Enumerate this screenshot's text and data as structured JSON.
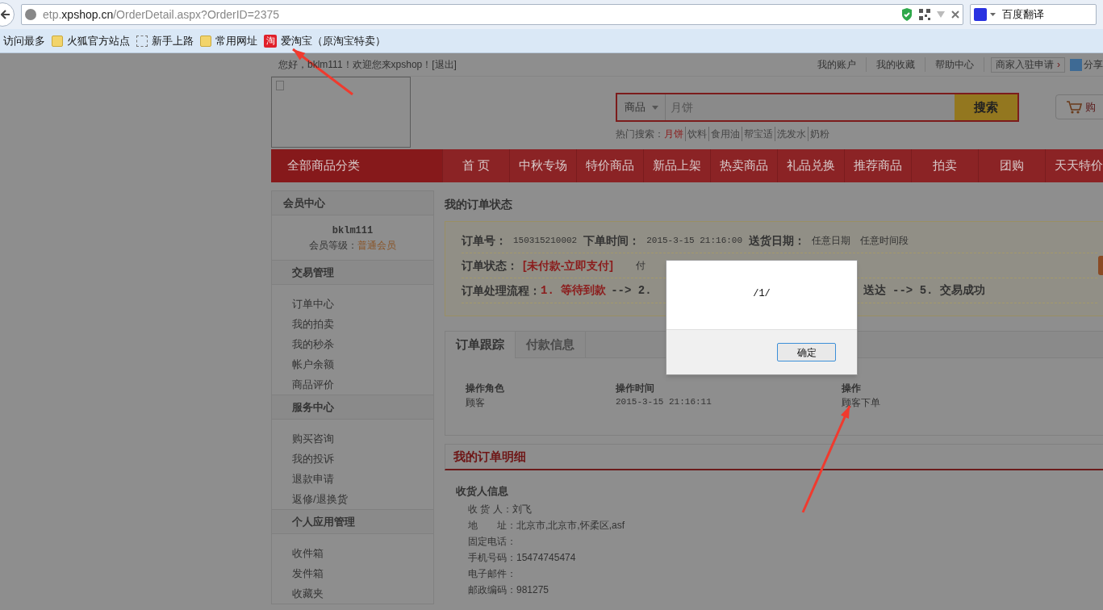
{
  "browser": {
    "url_prefix": "etp.",
    "url_domain": "xpshop.cn",
    "url_path": "/OrderDetail.aspx?OrderID=2375",
    "search_engine": "百度翻译",
    "bookmarks": [
      {
        "label": "访问最多",
        "kind": "recent"
      },
      {
        "label": "火狐官方站点",
        "kind": "folder"
      },
      {
        "label": "新手上路",
        "kind": "page"
      },
      {
        "label": "常用网址",
        "kind": "folder"
      },
      {
        "label": "爱淘宝（原淘宝特卖）",
        "kind": "taobao",
        "badge": "淘"
      }
    ]
  },
  "top_bar": {
    "welcome": "您好，bklm111！欢迎您来xpshop！[退出]",
    "links": [
      "我的账户",
      "我的收藏",
      "帮助中心"
    ],
    "merchant_button": "商家入驻申请",
    "merchant_caret": "›",
    "share": "分享"
  },
  "search": {
    "category": "商品",
    "value": "月饼",
    "button": "搜索",
    "hot_label": "热门搜索：",
    "hot_terms": [
      {
        "label": "月饼",
        "selected": true
      },
      {
        "label": "饮料",
        "selected": false
      },
      {
        "label": "食用油",
        "selected": false
      },
      {
        "label": "帮宝适",
        "selected": false
      },
      {
        "label": "洗发水",
        "selected": false
      },
      {
        "label": "奶粉",
        "selected": false
      }
    ],
    "cart": "购"
  },
  "nav": {
    "all_categories": "全部商品分类",
    "items": [
      "首 页",
      "中秋专场",
      "特价商品",
      "新品上架",
      "热卖商品",
      "礼品兑换",
      "推荐商品",
      "拍卖",
      "团购",
      "天天特价"
    ]
  },
  "sidebar": {
    "title": "会员中心",
    "username": "bklm111",
    "level_label": "会员等级：",
    "level": "普通会员",
    "sections": [
      {
        "title": "交易管理",
        "items": [
          "订单中心",
          "我的拍卖",
          "我的秒杀",
          "帐户余额",
          "商品评价"
        ]
      },
      {
        "title": "服务中心",
        "items": [
          "购买咨询",
          "我的投诉",
          "退款申请",
          "返修/退换货"
        ]
      },
      {
        "title": "个人应用管理",
        "items": [
          "收件箱",
          "发件箱",
          "收藏夹"
        ]
      }
    ]
  },
  "order_status": {
    "title": "我的订单状态",
    "order_no_label": "订单号：",
    "order_no": "150315210002",
    "time_label": "下单时间：",
    "time": "2015-3-15 21:16:00",
    "delivery_label": "送货日期：",
    "delivery_date": "任意日期",
    "delivery_slot": "任意时间段",
    "status_label": "订单状态：",
    "status": "[未付款-立即支付]",
    "status_after": "付",
    "flow_label": "订单处理流程：",
    "flow_current": "1. 等待到款",
    "flow_next": "--> 2.",
    "flow_after": "送达 --> 5. 交易成功"
  },
  "tracking": {
    "tabs": [
      {
        "label": "订单跟踪",
        "selected": true
      },
      {
        "label": "付款信息",
        "selected": false
      }
    ],
    "columns": [
      "操作角色",
      "操作时间",
      "操作"
    ],
    "rows": [
      [
        "顾客",
        "2015-3-15 21:16:11",
        "顾客下单"
      ]
    ]
  },
  "details": {
    "title": "我的订单明细",
    "section": "收货人信息",
    "fields": [
      {
        "label": "收 货 人：",
        "value": "刘飞"
      },
      {
        "label": "地　　址：",
        "value": "北京市,北京市,怀柔区,asf"
      },
      {
        "label": "固定电话："
      },
      {
        "label": "手机号码：",
        "value": "15474745474"
      },
      {
        "label": "电子邮件："
      },
      {
        "label": "邮政编码：",
        "value": "981275"
      }
    ]
  },
  "dialog": {
    "message": "/1/",
    "button": "确定"
  }
}
